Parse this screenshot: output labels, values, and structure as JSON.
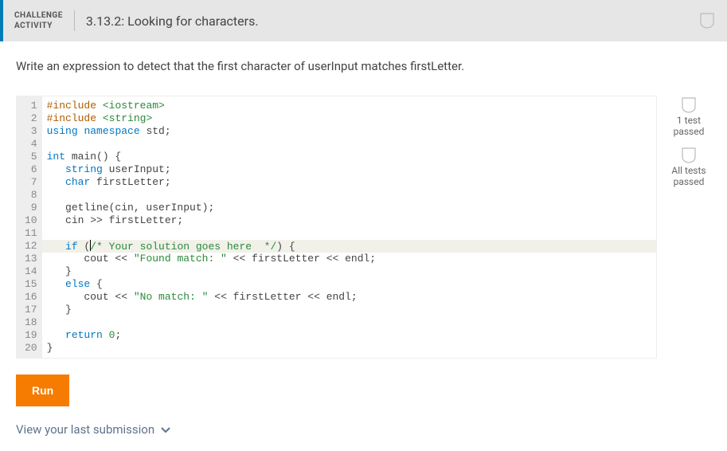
{
  "header": {
    "activity_label_line1": "CHALLENGE",
    "activity_label_line2": "ACTIVITY",
    "title": "3.13.2: Looking for characters."
  },
  "prompt": "Write an expression to detect that the first character of userInput matches firstLetter.",
  "code": {
    "line_count": 20,
    "highlighted_line": 12,
    "lines": {
      "l1_pre": "#include",
      "l1_lib": "<iostream>",
      "l2_pre": "#include",
      "l2_lib": "<string>",
      "l3_kw1": "using",
      "l3_kw2": "namespace",
      "l3_id": " std;",
      "l5_kw": "int",
      "l5_rest": " main() {",
      "l6_ind": "   ",
      "l6_t": "string",
      "l6_r": " userInput;",
      "l7_ind": "   ",
      "l7_t": "char",
      "l7_r": " firstLetter;",
      "l9": "   getline(cin, userInput);",
      "l10": "   cin >> firstLetter;",
      "l12_ind": "   ",
      "l12_kw": "if",
      "l12_open": " (",
      "l12_cmt": "/* Your solution goes here  */",
      "l12_close": ") {",
      "l13_ind": "      ",
      "l13_id": "cout << ",
      "l13_str": "\"Found match: \"",
      "l13_rest": " << firstLetter << endl;",
      "l14": "   }",
      "l15_ind": "   ",
      "l15_kw": "else",
      "l15_r": " {",
      "l16_ind": "      ",
      "l16_id": "cout << ",
      "l16_str": "\"No match: \"",
      "l16_rest": " << firstLetter << endl;",
      "l17": "   }",
      "l19_ind": "   ",
      "l19_kw": "return",
      "l19_sp": " ",
      "l19_num": "0",
      "l19_semi": ";",
      "l20": "}"
    }
  },
  "status": {
    "s1": "1 test passed",
    "s2": "All tests passed"
  },
  "buttons": {
    "run": "Run"
  },
  "links": {
    "last_submission": "View your last submission"
  }
}
